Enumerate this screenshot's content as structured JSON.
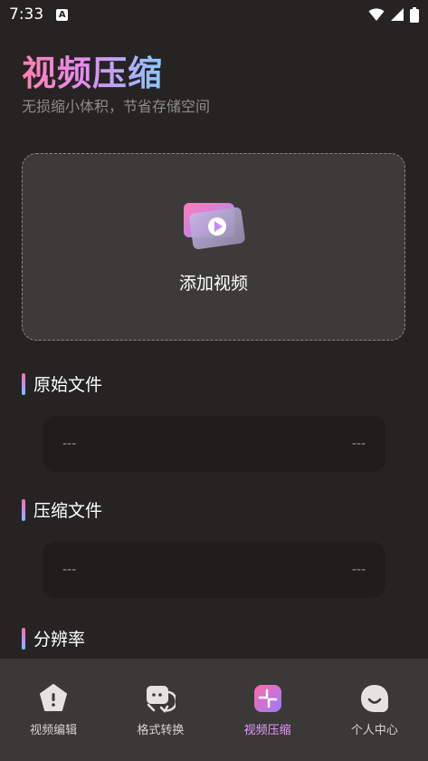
{
  "status_bar": {
    "time": "7:33",
    "notification_glyph": "A",
    "icons": [
      "wifi-icon",
      "signal-icon",
      "battery-icon"
    ]
  },
  "header": {
    "title": "视频压缩",
    "subtitle": "无损缩小体积，节省存储空间"
  },
  "add_video": {
    "label": "添加视频",
    "icon": "video-card-icon"
  },
  "sections": {
    "original": {
      "title": "原始文件",
      "left_value": "---",
      "right_value": "---"
    },
    "compressed": {
      "title": "压缩文件",
      "left_value": "---",
      "right_value": "---"
    },
    "resolution": {
      "title": "分辨率"
    }
  },
  "bottom_nav": {
    "items": [
      {
        "label": "视频编辑",
        "icon": "pentagon-icon",
        "active": false
      },
      {
        "label": "格式转换",
        "icon": "format-convert-icon",
        "active": false
      },
      {
        "label": "视频压缩",
        "icon": "compress-icon",
        "active": true
      },
      {
        "label": "个人中心",
        "icon": "smile-face-icon",
        "active": false
      }
    ]
  },
  "colors": {
    "background": "#252423",
    "card": "#3c3b39",
    "row": "#1f1e1d",
    "nav": "#3a3937",
    "accent_pink": "#ff6aa7",
    "accent_purple": "#e89bff",
    "accent_blue": "#7cc4ff"
  }
}
